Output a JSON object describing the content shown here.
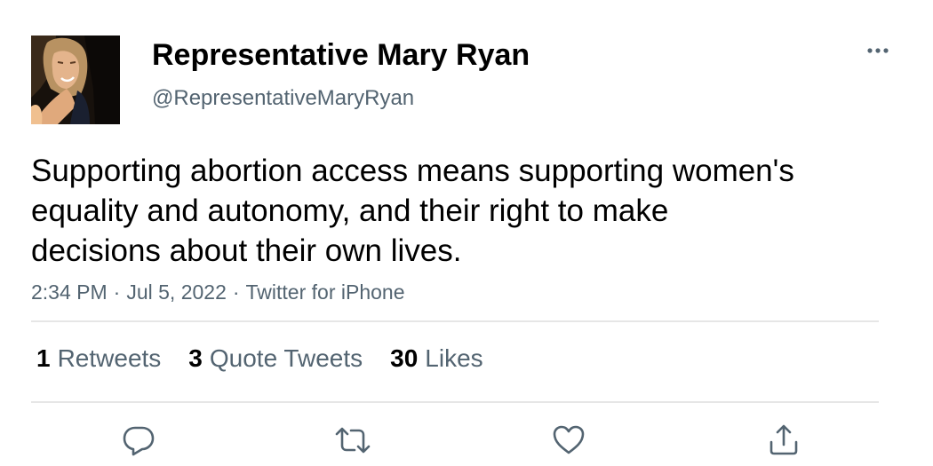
{
  "author": {
    "display_name": "Representative Mary Ryan",
    "handle": "@RepresentativeMaryRyan"
  },
  "tweet": {
    "text_lines": [
      "Supporting abortion access means supporting women's",
      "equality and autonomy, and their right to make",
      "decisions about their own lives."
    ],
    "time": "2:34 PM",
    "date": "Jul 5, 2022",
    "separator": "·",
    "source": "Twitter for iPhone"
  },
  "stats": {
    "retweets": {
      "count": "1",
      "label": "Retweets"
    },
    "quote_tweets": {
      "count": "3",
      "label": "Quote Tweets"
    },
    "likes": {
      "count": "30",
      "label": "Likes"
    }
  },
  "icons": {
    "more": "more-horizontal-icon",
    "reply": "reply-icon",
    "retweet": "retweet-icon",
    "like": "heart-icon",
    "share": "share-icon"
  },
  "colors": {
    "text": "#000000",
    "muted": "#536471",
    "divider": "#e6e6e6",
    "icon": "#536471"
  }
}
